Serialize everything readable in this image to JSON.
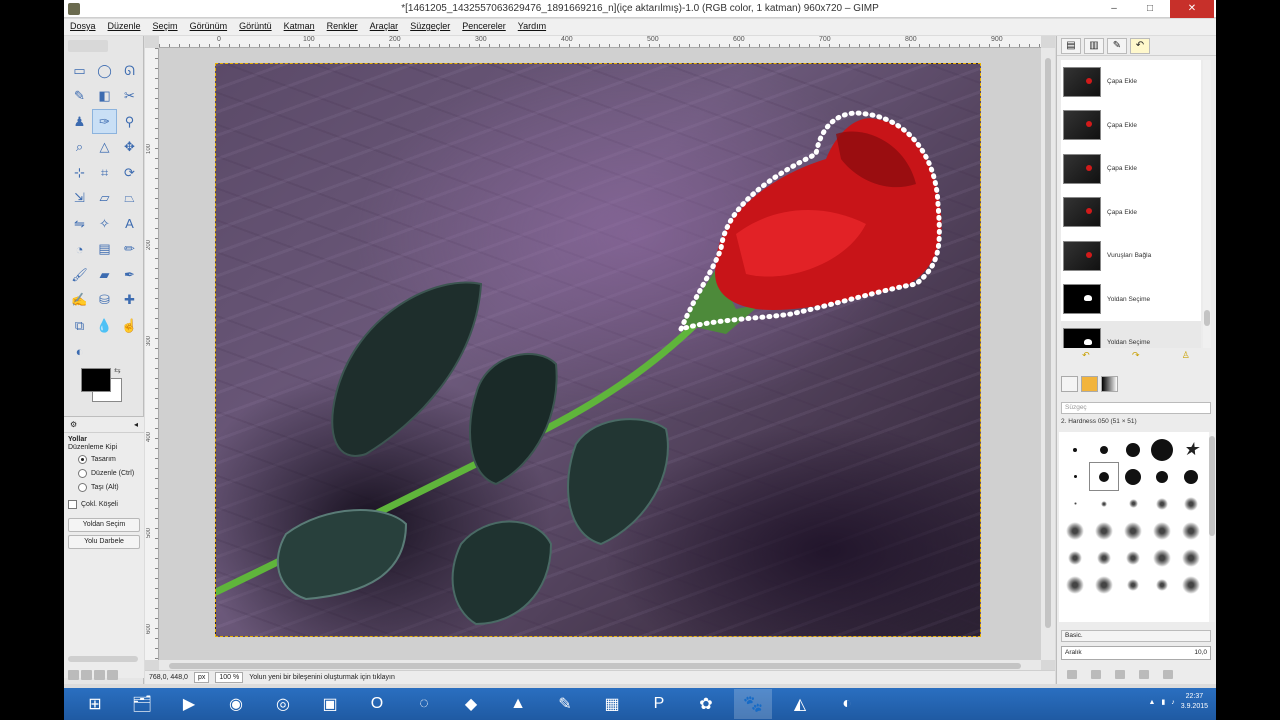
{
  "window": {
    "title": "*[1461205_1432557063629476_1891669216_n](içe aktarılmış)-1.0 (RGB color, 1 katman) 960x720 – GIMP",
    "min": "–",
    "max": "□",
    "close": "✕"
  },
  "menu": [
    "Dosya",
    "Düzenle",
    "Seçim",
    "Görünüm",
    "Görüntü",
    "Katman",
    "Renkler",
    "Araçlar",
    "Süzgeçler",
    "Pencereler",
    "Yardım"
  ],
  "toolbox": {
    "tools": [
      {
        "icon": "rect-select-icon",
        "glyph": "▭"
      },
      {
        "icon": "ellipse-select-icon",
        "glyph": "◯"
      },
      {
        "icon": "lasso-icon",
        "glyph": "ᘏ"
      },
      {
        "icon": "fuzzy-select-icon",
        "glyph": "✎"
      },
      {
        "icon": "color-select-icon",
        "glyph": "◧"
      },
      {
        "icon": "scissors-icon",
        "glyph": "✂"
      },
      {
        "icon": "foreground-select-icon",
        "glyph": "♟"
      },
      {
        "icon": "paths-icon",
        "glyph": "✑"
      },
      {
        "icon": "color-picker-icon",
        "glyph": "⚲"
      },
      {
        "icon": "zoom-icon",
        "glyph": "⌕"
      },
      {
        "icon": "measure-icon",
        "glyph": "△"
      },
      {
        "icon": "move-icon",
        "glyph": "✥"
      },
      {
        "icon": "align-icon",
        "glyph": "⊹"
      },
      {
        "icon": "crop-icon",
        "glyph": "⌗"
      },
      {
        "icon": "rotate-icon",
        "glyph": "⟳"
      },
      {
        "icon": "scale-icon",
        "glyph": "⇲"
      },
      {
        "icon": "shear-icon",
        "glyph": "▱"
      },
      {
        "icon": "perspective-icon",
        "glyph": "⏢"
      },
      {
        "icon": "flip-icon",
        "glyph": "⇋"
      },
      {
        "icon": "cage-icon",
        "glyph": "✧"
      },
      {
        "icon": "text-icon",
        "glyph": "A"
      },
      {
        "icon": "bucket-fill-icon",
        "glyph": "◔"
      },
      {
        "icon": "blend-icon",
        "glyph": "▤"
      },
      {
        "icon": "pencil-icon",
        "glyph": "✏"
      },
      {
        "icon": "paintbrush-icon",
        "glyph": "🖌"
      },
      {
        "icon": "eraser-icon",
        "glyph": "▰"
      },
      {
        "icon": "airbrush-icon",
        "glyph": "✒"
      },
      {
        "icon": "ink-icon",
        "glyph": "✍"
      },
      {
        "icon": "clone-icon",
        "glyph": "⛁"
      },
      {
        "icon": "heal-icon",
        "glyph": "✚"
      },
      {
        "icon": "perspective-clone-icon",
        "glyph": "⧉"
      },
      {
        "icon": "blur-icon",
        "glyph": "💧"
      },
      {
        "icon": "smudge-icon",
        "glyph": "☝"
      },
      {
        "icon": "dodge-burn-icon",
        "glyph": "◐"
      }
    ],
    "active_tool_index": 7,
    "options": {
      "heading": "Yollar",
      "mode_label": "Düzenleme Kipi",
      "modes": [
        "Tasarım",
        "Düzenle (Ctrl)",
        "Taşı (Alt)"
      ],
      "selected_mode": 0,
      "polygonal": "Çokl. Köşeli",
      "btn_selection": "Yoldan Seçim",
      "btn_stroke": "Yolu Darbele"
    }
  },
  "canvas": {
    "ruler_ticks_x": [
      "0",
      "100",
      "200",
      "300",
      "400",
      "500",
      "600",
      "700",
      "800",
      "900"
    ],
    "ruler_ticks_y": [
      "100",
      "200",
      "300",
      "400",
      "500",
      "600"
    ]
  },
  "status": {
    "coords": "768,0, 448,0",
    "unit": "px",
    "zoom": "100 %",
    "message": "Yolun yeni bir bileşenini oluşturmak için tıklayın"
  },
  "undo_history": [
    {
      "label": "Çapa Ekle",
      "mask": false
    },
    {
      "label": "Çapa Ekle",
      "mask": false
    },
    {
      "label": "Çapa Ekle",
      "mask": false
    },
    {
      "label": "Çapa Ekle",
      "mask": false
    },
    {
      "label": "Vuruşları Bağla",
      "mask": false
    },
    {
      "label": "Yoldan Seçime",
      "mask": true
    },
    {
      "label": "Yoldan Seçime",
      "mask": true
    }
  ],
  "brushes": {
    "filter_placeholder": "Süzgeç",
    "selected_name": "2. Hardness 050 (51 × 51)",
    "preset": "Basic.",
    "spacing_label": "Aralık",
    "spacing_value": "10,0"
  },
  "taskbar": {
    "apps": [
      {
        "icon": "file-explorer-icon",
        "glyph": "🗂"
      },
      {
        "icon": "media-player-icon",
        "glyph": "▶"
      },
      {
        "icon": "chrome-icon",
        "glyph": "◉"
      },
      {
        "icon": "firefox-icon",
        "glyph": "◎"
      },
      {
        "icon": "app-m-icon",
        "glyph": "▣"
      },
      {
        "icon": "opera-icon",
        "glyph": "O"
      },
      {
        "icon": "blender-icon",
        "glyph": "◌"
      },
      {
        "icon": "cube-icon",
        "glyph": "◆"
      },
      {
        "icon": "vlc-icon",
        "glyph": "▲"
      },
      {
        "icon": "paint-icon",
        "glyph": "✎"
      },
      {
        "icon": "image-icon",
        "glyph": "▦"
      },
      {
        "icon": "powerpoint-icon",
        "glyph": "P"
      },
      {
        "icon": "palette-icon",
        "glyph": "✿"
      },
      {
        "icon": "gimp-icon",
        "glyph": "🐾"
      },
      {
        "icon": "inkscape-icon",
        "glyph": "◭"
      },
      {
        "icon": "obs-icon",
        "glyph": "◐"
      }
    ],
    "active_index": 13,
    "time": "22:37",
    "date": "3.9.2015"
  },
  "colors": {
    "accent": "#3c6bb0",
    "selection_marching_ants": "#e8b200",
    "rose": "#d21a1a"
  }
}
